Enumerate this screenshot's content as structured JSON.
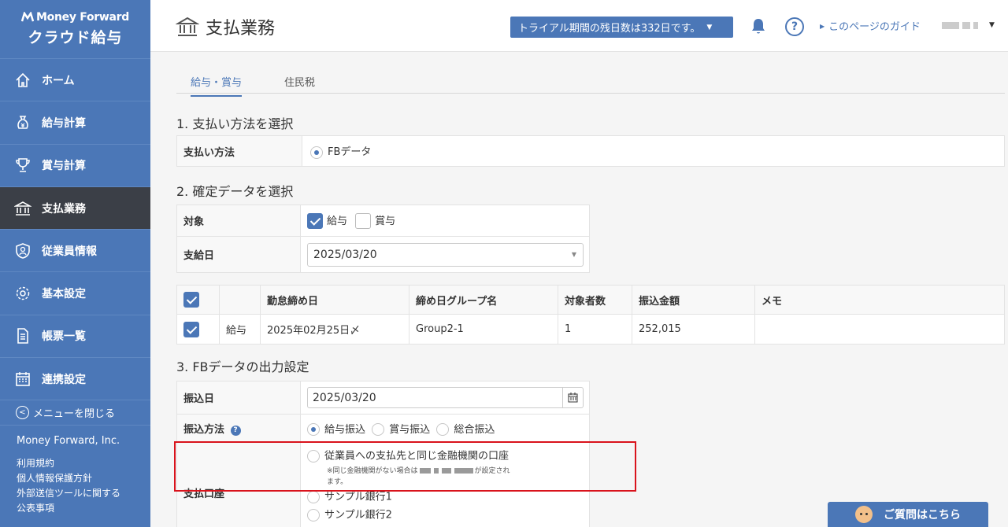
{
  "sidebar": {
    "brand": "Money Forward",
    "product": "クラウド給与",
    "items": [
      {
        "label": "ホーム",
        "icon": "home-icon"
      },
      {
        "label": "給与計算",
        "icon": "money-bag-icon"
      },
      {
        "label": "賞与計算",
        "icon": "trophy-icon"
      },
      {
        "label": "支払業務",
        "icon": "bank-icon",
        "active": true
      },
      {
        "label": "従業員情報",
        "icon": "employee-icon"
      },
      {
        "label": "基本設定",
        "icon": "gear-icon"
      },
      {
        "label": "帳票一覧",
        "icon": "document-icon"
      },
      {
        "label": "連携設定",
        "icon": "calendar-icon"
      }
    ],
    "close_menu": "メニューを閉じる",
    "company": "Money Forward, Inc.",
    "links": [
      "利用規約",
      "個人情報保護方針",
      "外部送信ツールに関する",
      "公表事項"
    ]
  },
  "header": {
    "title": "支払業務",
    "trial": "トライアル期間の残日数は332日です。",
    "guide": "このページのガイド"
  },
  "tabs": [
    {
      "label": "給与・賞与",
      "active": true
    },
    {
      "label": "住民税"
    }
  ],
  "section1": {
    "title": "1. 支払い方法を選択",
    "label": "支払い方法",
    "option": "FBデータ"
  },
  "section2": {
    "title": "2. 確定データを選択",
    "target_label": "対象",
    "opt_salary": "給与",
    "opt_bonus": "賞与",
    "date_label": "支給日",
    "date_value": "2025/03/20"
  },
  "grid": {
    "headers": [
      "",
      "",
      "勤怠締め日",
      "締め日グループ名",
      "対象者数",
      "振込金額",
      "メモ"
    ],
    "rows": [
      {
        "type": "給与",
        "closing": "2025年02月25日〆",
        "group": "Group2-1",
        "count": "1",
        "amount": "252,015",
        "memo": ""
      }
    ]
  },
  "section3": {
    "title": "3. FBデータの出力設定",
    "transfer_date_label": "振込日",
    "transfer_date": "2025/03/20",
    "method_label": "振込方法",
    "methods": [
      "給与振込",
      "賞与振込",
      "総合振込"
    ],
    "account_label": "支払口座",
    "account_opt1": "従業員への支払先と同じ金融機関の口座",
    "account_note1": "※同じ金融機関がない場合は",
    "account_note2": "が設定され",
    "account_note3": "ます。",
    "banks": [
      "サンプル銀行1",
      "サンプル銀行2"
    ]
  },
  "question_button": "ご質問はこちら",
  "colors": {
    "accent": "#4b77b7",
    "highlight": "#d9131c",
    "active_nav": "#3b3f47"
  }
}
